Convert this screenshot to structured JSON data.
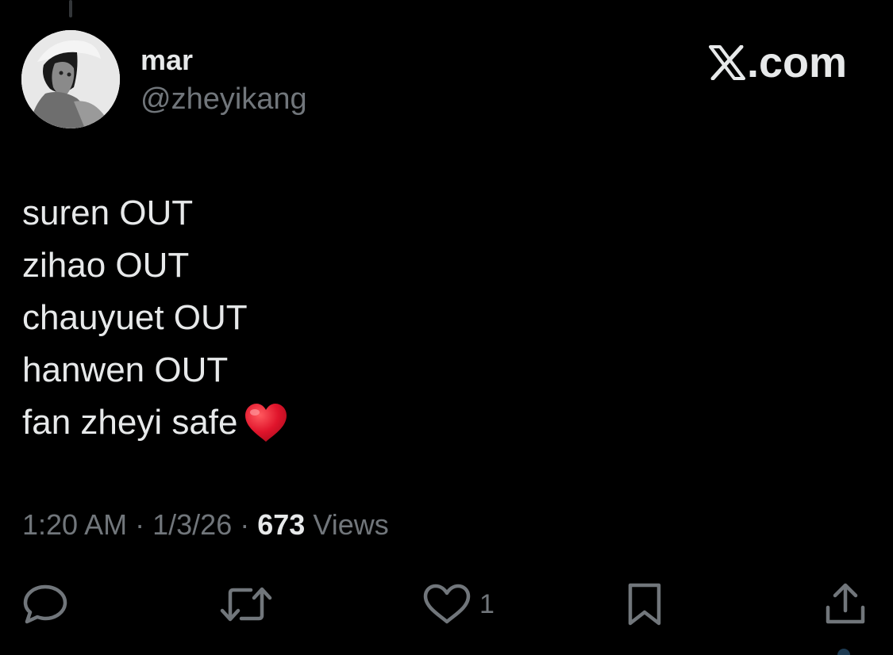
{
  "user": {
    "name": "mar",
    "handle": "@zheyikang"
  },
  "brand": {
    "label": ".com",
    "icon": "x-logo-icon"
  },
  "tweet": {
    "lines": [
      "suren OUT",
      "zihao OUT",
      "chauyuet OUT",
      "hanwen OUT",
      "fan zheyi safe"
    ],
    "emoji": "red-heart"
  },
  "meta": {
    "time": "1:20 AM",
    "separator": "·",
    "date": "1/3/26",
    "views_count": "673",
    "views_label": "Views"
  },
  "actions": {
    "reply_icon": "reply-icon",
    "repost_icon": "repost-icon",
    "like_icon": "heart-outline-icon",
    "like_count": "1",
    "bookmark_icon": "bookmark-icon",
    "share_icon": "share-icon"
  },
  "colors": {
    "background": "#000000",
    "text_primary": "#e7e9ea",
    "text_secondary": "#71767b",
    "heart": "#e0142b"
  }
}
